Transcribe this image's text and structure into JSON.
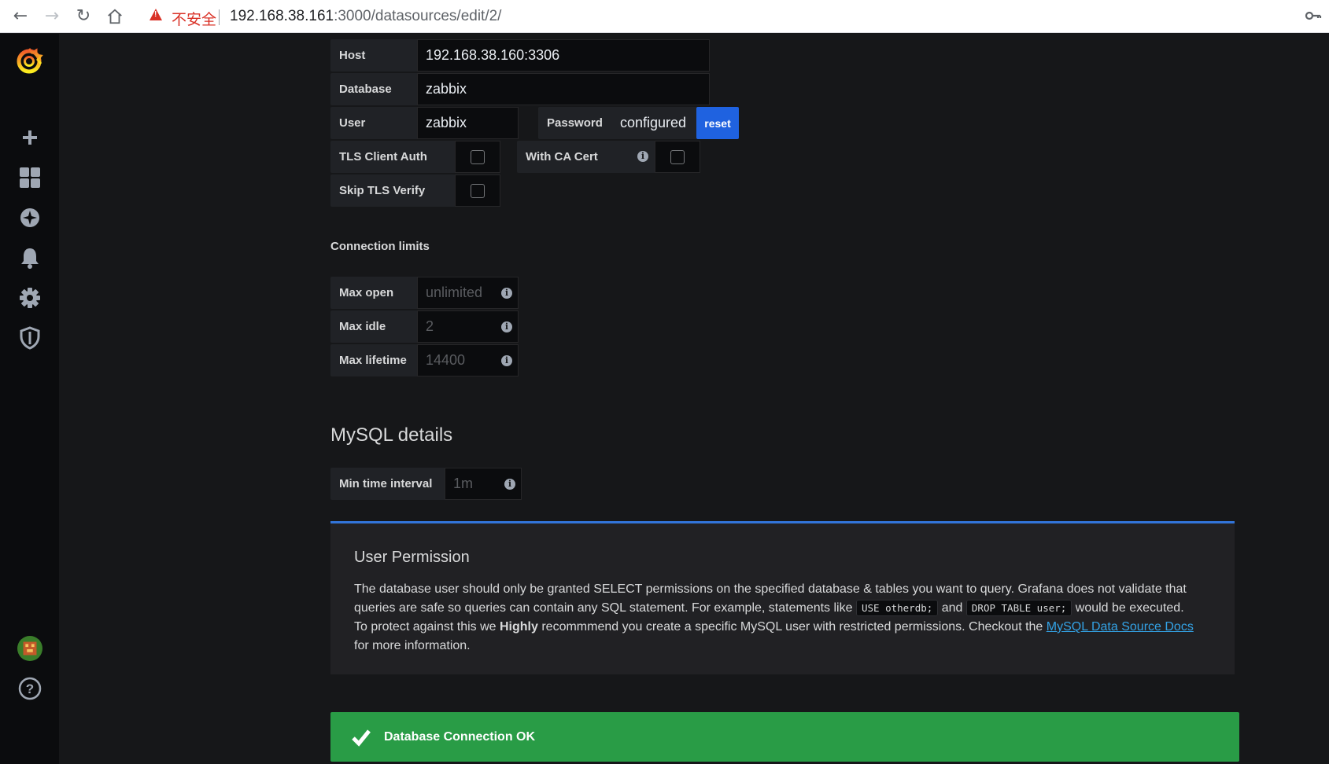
{
  "browser": {
    "insecure_label": "不安全",
    "url_host": "192.168.38.161",
    "url_rest": ":3000/datasources/edit/2/"
  },
  "sidebar": {
    "items": [
      "create",
      "dashboards",
      "explore",
      "alerting",
      "configuration",
      "server-admin",
      "profile",
      "help"
    ]
  },
  "connection": {
    "host_label": "Host",
    "host_value": "192.168.38.160:3306",
    "database_label": "Database",
    "database_value": "zabbix",
    "user_label": "User",
    "user_value": "zabbix",
    "password_label": "Password",
    "password_value": "configured",
    "reset_label": "reset",
    "tls_client_auth_label": "TLS Client Auth",
    "with_ca_cert_label": "With CA Cert",
    "skip_tls_verify_label": "Skip TLS Verify"
  },
  "limits": {
    "title": "Connection limits",
    "max_open_label": "Max open",
    "max_open_placeholder": "unlimited",
    "max_idle_label": "Max idle",
    "max_idle_placeholder": "2",
    "max_lifetime_label": "Max lifetime",
    "max_lifetime_placeholder": "14400"
  },
  "mysql": {
    "title": "MySQL details",
    "min_interval_label": "Min time interval",
    "min_interval_placeholder": "1m"
  },
  "permission": {
    "title": "User Permission",
    "line1": "The database user should only be granted SELECT permissions on the specified database & tables you want to query. Grafana does not validate that",
    "line2_a": "queries are safe so queries can contain any SQL statement. For example, statements like",
    "code1": "USE otherdb;",
    "line2_b": "and",
    "code2": "DROP TABLE user;",
    "line2_c": "would be executed.",
    "line3_a": "To protect against this we",
    "line3_strong": "Highly",
    "line3_b": "recommmend you create a specific MySQL user with restricted permissions. Checkout the",
    "link": "MySQL Data Source Docs",
    "line4": "for more information."
  },
  "alert": {
    "message": "Database Connection OK",
    "color": "#299c46"
  }
}
